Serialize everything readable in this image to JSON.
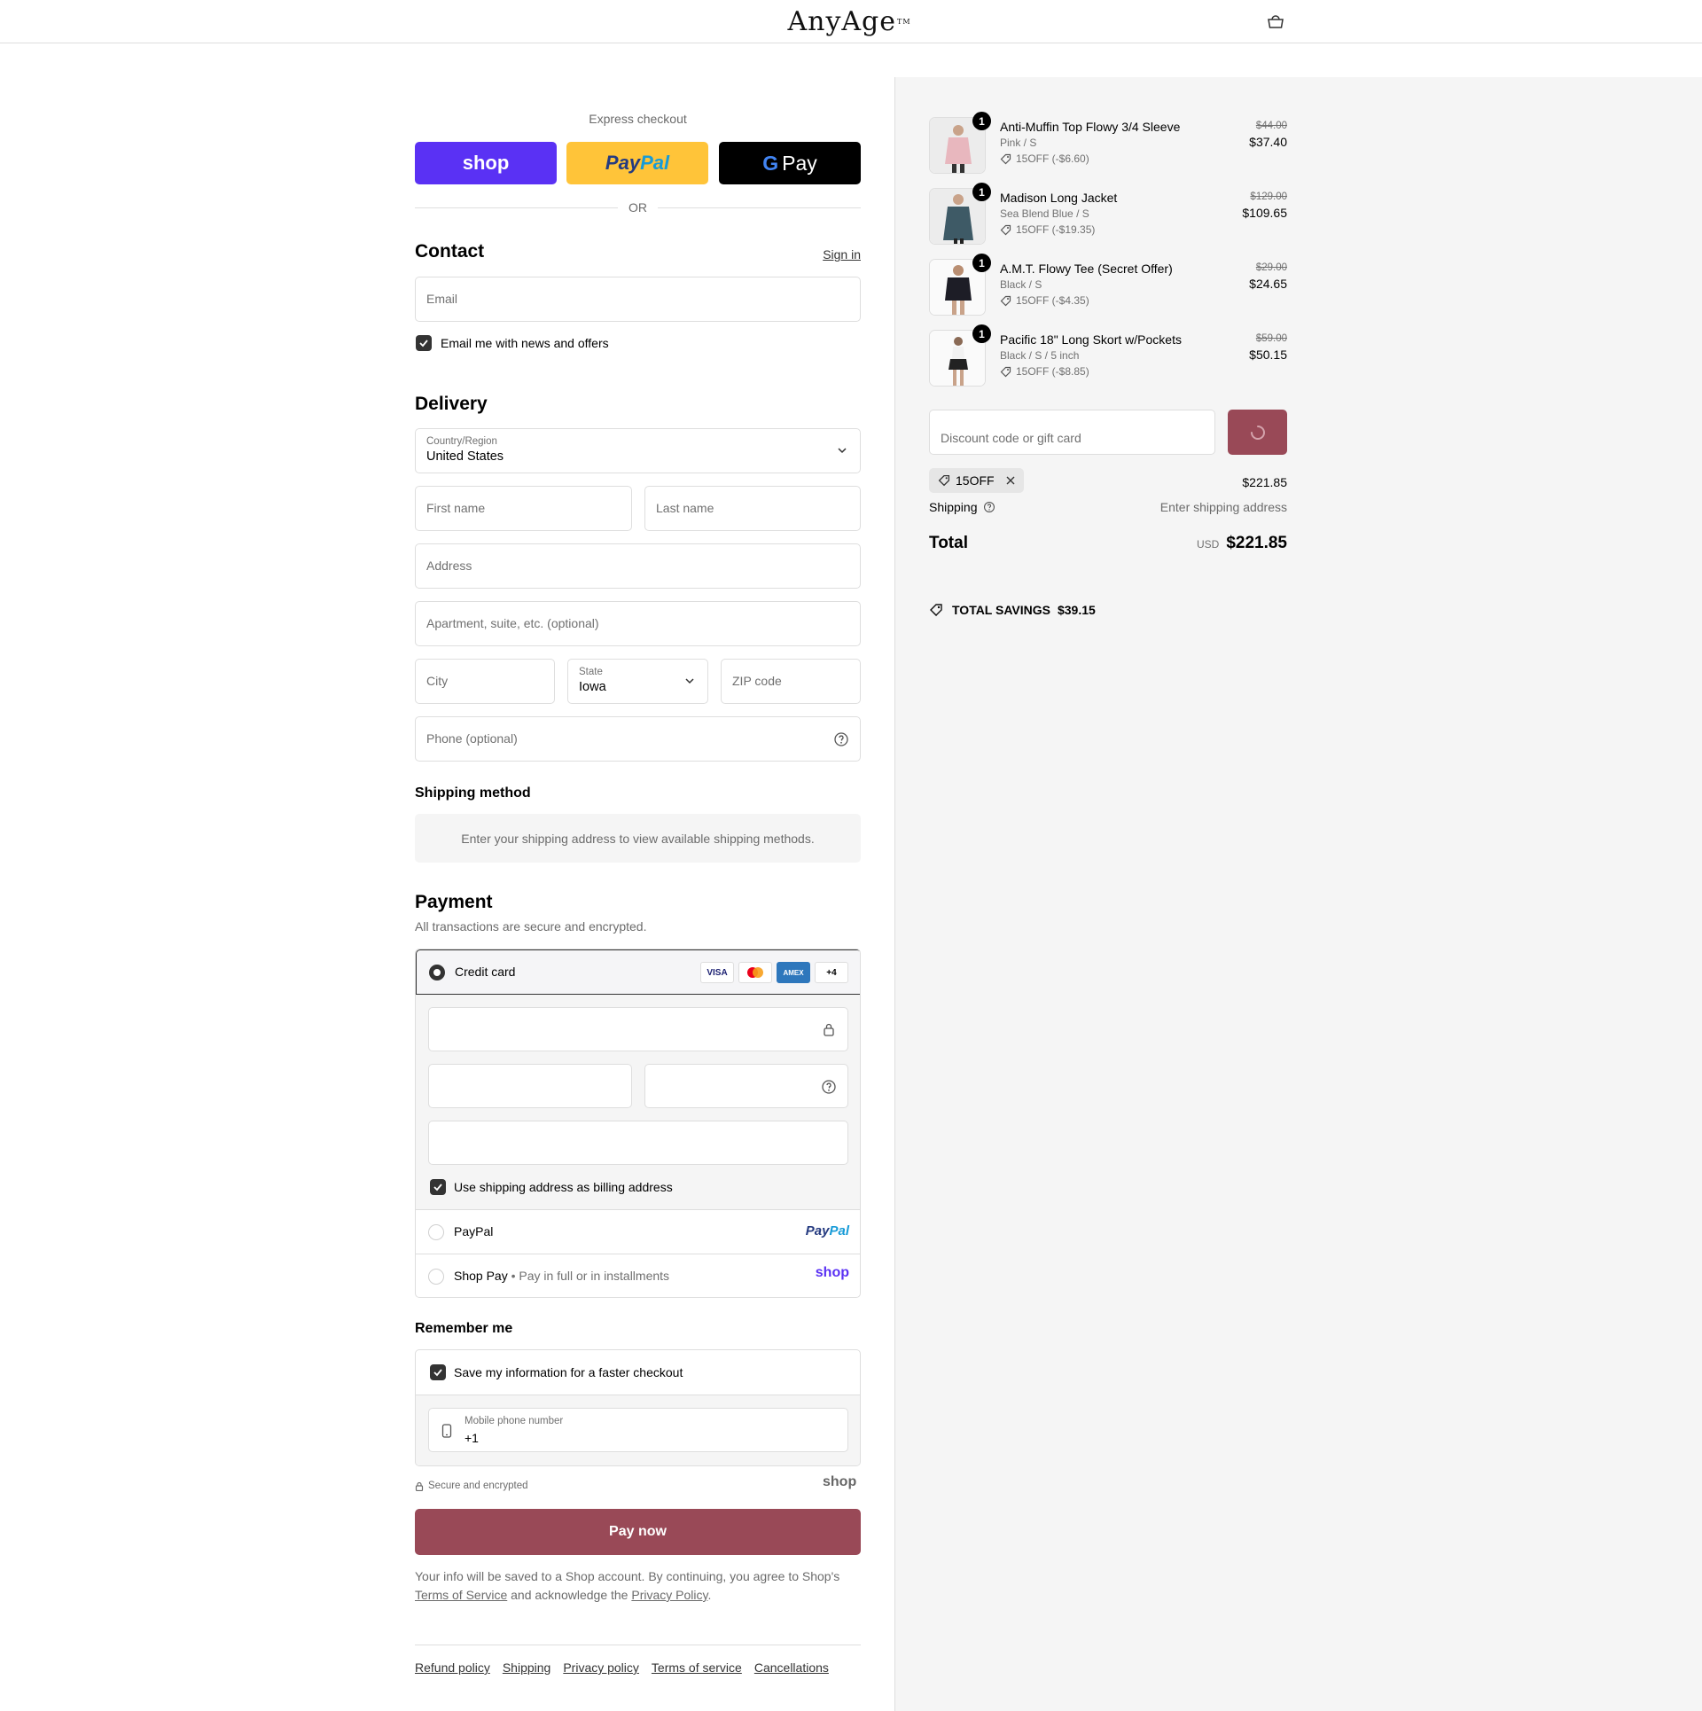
{
  "header": {
    "logo_text": "AnyAge",
    "logo_tm": "TM"
  },
  "express": {
    "label": "Express checkout",
    "shop_label": "shop",
    "paypal_part1": "Pay",
    "paypal_part2": "Pal",
    "gpay_label": "Pay",
    "or_label": "OR"
  },
  "contact": {
    "title": "Contact",
    "sign_in": "Sign in",
    "email_placeholder": "Email",
    "newsletter_label": "Email me with news and offers"
  },
  "delivery": {
    "title": "Delivery",
    "country_label": "Country/Region",
    "country_value": "United States",
    "first_name_placeholder": "First name",
    "last_name_placeholder": "Last name",
    "address_placeholder": "Address",
    "apartment_placeholder": "Apartment, suite, etc. (optional)",
    "city_placeholder": "City",
    "state_label": "State",
    "state_value": "Iowa",
    "zip_placeholder": "ZIP code",
    "phone_placeholder": "Phone (optional)"
  },
  "shipping_method": {
    "title": "Shipping method",
    "notice": "Enter your shipping address to view available shipping methods."
  },
  "payment": {
    "title": "Payment",
    "subtitle": "All transactions are secure and encrypted.",
    "credit_card_label": "Credit card",
    "card_badges": [
      "VISA",
      "MC",
      "AMEX",
      "+4"
    ],
    "billing_label": "Use shipping address as billing address",
    "paypal_label": "PayPal",
    "paypal_logo_part1": "Pay",
    "paypal_logo_part2": "Pal",
    "shoppay_label": "Shop Pay",
    "shoppay_sub": "Pay in full or in installments",
    "shoppay_logo": "shop"
  },
  "remember": {
    "title": "Remember me",
    "save_label": "Save my information for a faster checkout",
    "mobile_label": "Mobile phone number",
    "mobile_value": "+1",
    "secure_label": "Secure and encrypted",
    "shop_logo": "shop"
  },
  "pay_now_label": "Pay now",
  "legal": {
    "line1": "Your info will be saved to a Shop account. By continuing, you agree to Shop's",
    "terms": "Terms of Service",
    "mid": "and acknowledge the",
    "privacy": "Privacy Policy",
    "end": "."
  },
  "footer": {
    "links": [
      "Refund policy",
      "Shipping",
      "Privacy policy",
      "Terms of service",
      "Cancellations"
    ]
  },
  "summary": {
    "items": [
      {
        "qty": "1",
        "title": "Anti-Muffin Top Flowy 3/4 Sleeve",
        "variant": "Pink / S",
        "discount": "15OFF (-$6.60)",
        "original": "$44.00",
        "price": "$37.40",
        "color": "#e8b7be"
      },
      {
        "qty": "1",
        "title": "Madison Long Jacket",
        "variant": "Sea Blend Blue / S",
        "discount": "15OFF (-$19.35)",
        "original": "$129.00",
        "price": "$109.65",
        "color": "#3e5a66"
      },
      {
        "qty": "1",
        "title": "A.M.T. Flowy Tee (Secret Offer)",
        "variant": "Black / S",
        "discount": "15OFF (-$4.35)",
        "original": "$29.00",
        "price": "$24.65",
        "color": "#1d1d26"
      },
      {
        "qty": "1",
        "title": "Pacific 18\" Long Skort w/Pockets",
        "variant": "Black / S / 5 inch",
        "discount": "15OFF (-$8.85)",
        "original": "$59.00",
        "price": "$50.15",
        "color": "#222222"
      }
    ],
    "discount_placeholder": "Discount code or gift card",
    "applied_code": "15OFF",
    "subtotal": "$221.85",
    "shipping_label": "Shipping",
    "shipping_value": "Enter shipping address",
    "total_label": "Total",
    "currency": "USD",
    "total": "$221.85",
    "savings_label": "TOTAL SAVINGS",
    "savings_value": "$39.15"
  },
  "colors": {
    "accent": "#994957",
    "shop_purple": "#5a31f4",
    "paypal_yellow": "#ffc439"
  }
}
